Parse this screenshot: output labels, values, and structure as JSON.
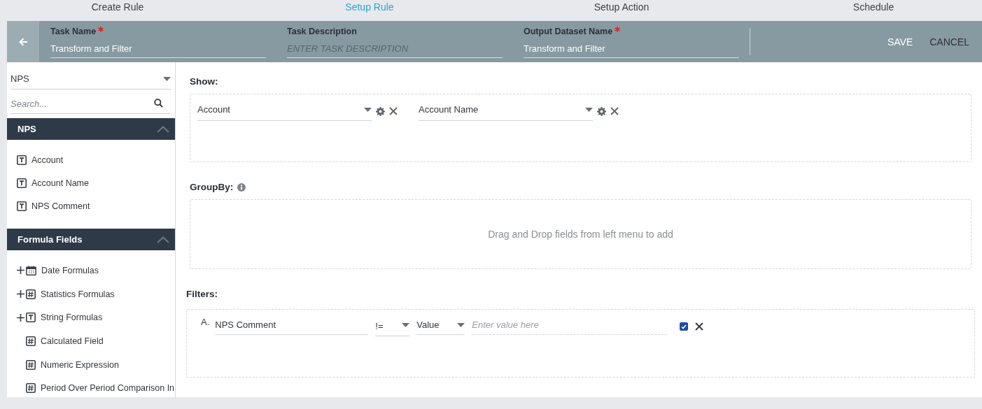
{
  "steps": [
    {
      "label": "Create Rule",
      "selected": false
    },
    {
      "label": "Setup Rule",
      "selected": true
    },
    {
      "label": "Setup Action",
      "selected": false
    },
    {
      "label": "Schedule",
      "selected": false
    }
  ],
  "header": {
    "fields": [
      {
        "label": "Task Name",
        "required": true,
        "value": "Transform and Filter"
      },
      {
        "label": "Task Description",
        "required": false,
        "placeholder": "ENTER TASK DESCRIPTION"
      },
      {
        "label": "Output Dataset Name",
        "required": true,
        "value": "Transform and Filter"
      }
    ],
    "buttons": [
      {
        "label": "SAVE",
        "kind": "primary"
      },
      {
        "label": "CANCEL",
        "kind": "secondary"
      }
    ]
  },
  "sidebar": {
    "source": "NPS",
    "search": {
      "placeholder": "Search..."
    },
    "sections": [
      {
        "title": "NPS",
        "expanded": true,
        "items": [
          {
            "label": "Account",
            "kind": "text",
            "expandable": false
          },
          {
            "label": "Account Name",
            "kind": "text",
            "expandable": false
          },
          {
            "label": "NPS Comment",
            "kind": "text",
            "expandable": false
          }
        ]
      },
      {
        "title": "Formula Fields",
        "expanded": true,
        "items": [
          {
            "label": "Date Formulas",
            "kind": "date",
            "expandable": true
          },
          {
            "label": "Statistics Formulas",
            "kind": "number",
            "expandable": true
          },
          {
            "label": "String Formulas",
            "kind": "text",
            "expandable": true
          },
          {
            "label": "Calculated Field",
            "kind": "number",
            "expandable": false
          },
          {
            "label": "Numeric Expression",
            "kind": "number",
            "expandable": false
          },
          {
            "label": "Period Over Period Comparison In",
            "kind": "number",
            "expandable": false
          }
        ]
      }
    ]
  },
  "show": {
    "label": "Show:",
    "fields": [
      {
        "value": "Account"
      },
      {
        "value": "Account Name"
      }
    ]
  },
  "group_by": {
    "label": "GroupBy:",
    "hint": "Drag and Drop fields from left menu to add"
  },
  "filters": {
    "label": "Filters:",
    "rows": [
      {
        "letter": "A.",
        "field": "NPS Comment",
        "operator": "!=",
        "value_type": "Value",
        "placeholder": "Enter value here",
        "checked": true
      }
    ]
  }
}
